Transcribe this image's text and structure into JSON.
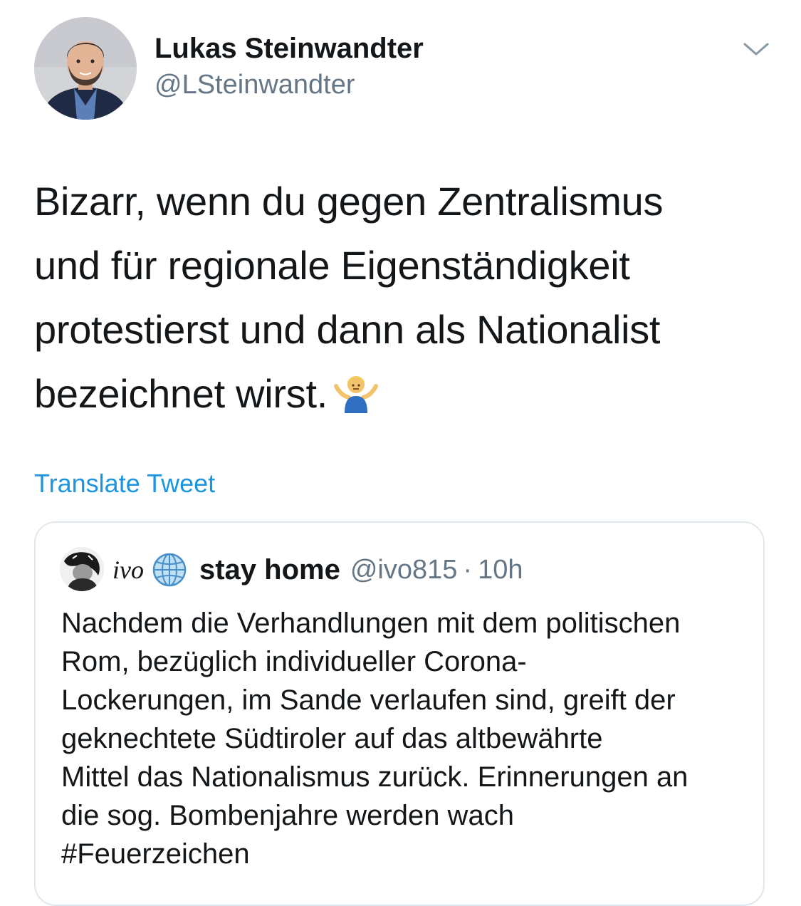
{
  "author": {
    "name": "Lukas Steinwandter",
    "handle": "@LSteinwandter"
  },
  "tweet": {
    "lines": [
      "Bizarr, wenn du gegen Zentralismus",
      "und für regionale Eigenständigkeit",
      "protestierst und dann als Nationalist",
      "bezeichnet wirst."
    ],
    "emoji": "shrug-emoji"
  },
  "translate_label": "Translate Tweet",
  "quoted": {
    "name_prefix": "ivo",
    "display_name": "stay home",
    "handle": "@ivo815",
    "separator": "·",
    "time": "10h",
    "lines": [
      "Nachdem die Verhandlungen mit dem politischen",
      "Rom, bezüglich individueller Corona-",
      "Lockerungen, im Sande verlaufen sind, greift der",
      "geknechtete Südtiroler auf das altbewährte",
      "Mittel das Nationalismus zurück. Erinnerungen an",
      "die sog. Bombenjahre werden wach",
      "#Feuerzeichen"
    ]
  },
  "colors": {
    "text": "#14171a",
    "secondary": "#657786",
    "link": "#1b95e0",
    "border": "#e1e8ed"
  },
  "icons": {
    "menu": "chevron-down-icon",
    "globe": "globe-icon"
  }
}
